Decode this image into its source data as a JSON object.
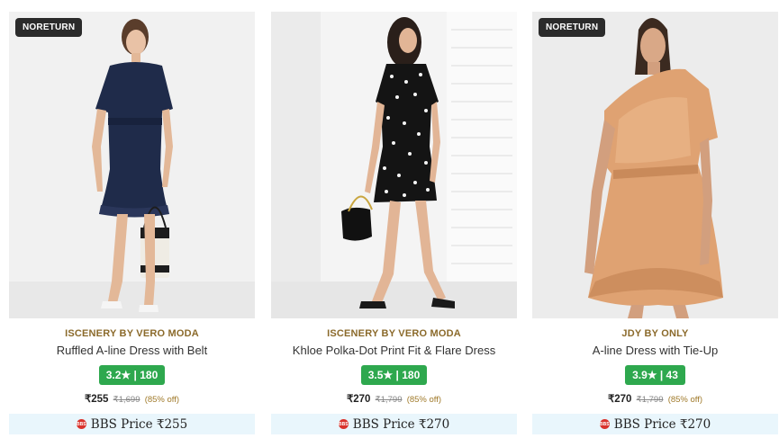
{
  "products": [
    {
      "badge": "NORETURN",
      "image": "woman-navy-ruffled-dress-photo",
      "brand": "ISCENERY BY VERO MODA",
      "title": "Ruffled A-line Dress with Belt",
      "rating": "3.2★ | 180",
      "price": "₹255",
      "mrp": "₹1,699",
      "discount": "(85% off)",
      "bbs_label": "BBS Price ₹255"
    },
    {
      "badge": "",
      "image": "woman-polka-dot-dress-photo",
      "brand": "ISCENERY BY VERO MODA",
      "title": "Khloe Polka-Dot Print Fit & Flare Dress",
      "rating": "3.5★ | 180",
      "price": "₹270",
      "mrp": "₹1,799",
      "discount": "(85% off)",
      "bbs_label": "BBS Price ₹270"
    },
    {
      "badge": "NORETURN",
      "image": "woman-peach-satin-dress-photo",
      "brand": "JDY BY ONLY",
      "title": "A-line Dress with Tie-Up",
      "rating": "3.9★ | 43",
      "price": "₹270",
      "mrp": "₹1,799",
      "discount": "(85% off)",
      "bbs_label": "BBS Price ₹270"
    }
  ],
  "colors": {
    "rating_green": "#2ea84e",
    "brand_gold": "#8b6a2b",
    "bbs_bg": "#e9f6fc",
    "badge_bg": "#2b2b2b"
  }
}
